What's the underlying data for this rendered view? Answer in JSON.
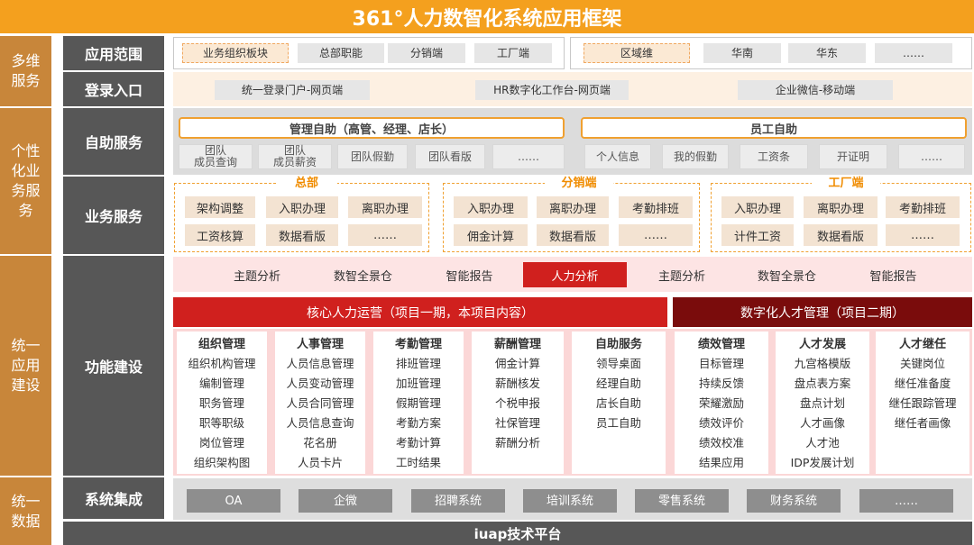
{
  "title": "361°人力数智化系统应用框架",
  "left_categories": [
    "多维服务",
    "个性化业务服务",
    "统一应用建设",
    "统一数据"
  ],
  "row_labels": {
    "scope": "应用范围",
    "login": "登录入口",
    "self_service": "自助服务",
    "business": "业务服务",
    "function": "功能建设",
    "integration": "系统集成"
  },
  "scope_items_left": [
    "业务组织板块",
    "总部职能",
    "分销端",
    "工厂端"
  ],
  "scope_items_right": [
    "区域维",
    "华南",
    "华东",
    "……"
  ],
  "login_items": [
    "统一登录门户-网页端",
    "HR数字化工作台-网页端",
    "企业微信-移动端"
  ],
  "self_service": {
    "manager_header": "管理自助（高管、经理、店长）",
    "employee_header": "员工自助",
    "manager_items": [
      "团队\n成员查询",
      "团队\n成员薪资",
      "团队假勤",
      "团队看版",
      "……"
    ],
    "employee_items": [
      "个人信息",
      "我的假勤",
      "工资条",
      "开证明",
      "……"
    ]
  },
  "business": {
    "groups": [
      {
        "label": "总部",
        "items": [
          "架构调整",
          "入职办理",
          "离职办理",
          "工资核算",
          "数据看版",
          "……"
        ]
      },
      {
        "label": "分销端",
        "items": [
          "入职办理",
          "离职办理",
          "考勤排班",
          "佣金计算",
          "数据看版",
          "……"
        ]
      },
      {
        "label": "工厂端",
        "items": [
          "入职办理",
          "离职办理",
          "考勤排班",
          "计件工资",
          "数据看版",
          "……"
        ]
      }
    ]
  },
  "function": {
    "tabs": [
      "主题分析",
      "数智全景仓",
      "智能报告",
      "人力分析",
      "主题分析",
      "数智全景仓",
      "智能报告"
    ],
    "banner_left": "核心人力运营（项目一期，本项目内容）",
    "banner_right": "数字化人才管理（项目二期）",
    "columns": [
      {
        "header": "组织管理",
        "items": [
          "组织机构管理",
          "编制管理",
          "职务管理",
          "职等职级",
          "岗位管理",
          "组织架构图"
        ]
      },
      {
        "header": "人事管理",
        "items": [
          "人员信息管理",
          "人员变动管理",
          "人员合同管理",
          "人员信息查询",
          "花名册",
          "人员卡片"
        ]
      },
      {
        "header": "考勤管理",
        "items": [
          "排班管理",
          "加班管理",
          "假期管理",
          "考勤方案",
          "考勤计算",
          "工时结果"
        ]
      },
      {
        "header": "薪酬管理",
        "items": [
          "佣金计算",
          "薪酬核发",
          "个税申报",
          "社保管理",
          "薪酬分析"
        ]
      },
      {
        "header": "自助服务",
        "items": [
          "领导桌面",
          "经理自助",
          "店长自助",
          "员工自助"
        ]
      },
      {
        "header": "绩效管理",
        "items": [
          "目标管理",
          "持续反馈",
          "荣耀激励",
          "绩效评价",
          "绩效校准",
          "结果应用"
        ]
      },
      {
        "header": "人才发展",
        "items": [
          "九宫格模版",
          "盘点表方案",
          "盘点计划",
          "人才画像",
          "人才池",
          "IDP发展计划"
        ]
      },
      {
        "header": "人才继任",
        "items": [
          "关键岗位",
          "继任准备度",
          "继任跟踪管理",
          "继任者画像"
        ]
      }
    ]
  },
  "integration_items": [
    "OA",
    "企微",
    "招聘系统",
    "培训系统",
    "零售系统",
    "财务系统",
    "……"
  ],
  "platform": "iuap技术平台"
}
